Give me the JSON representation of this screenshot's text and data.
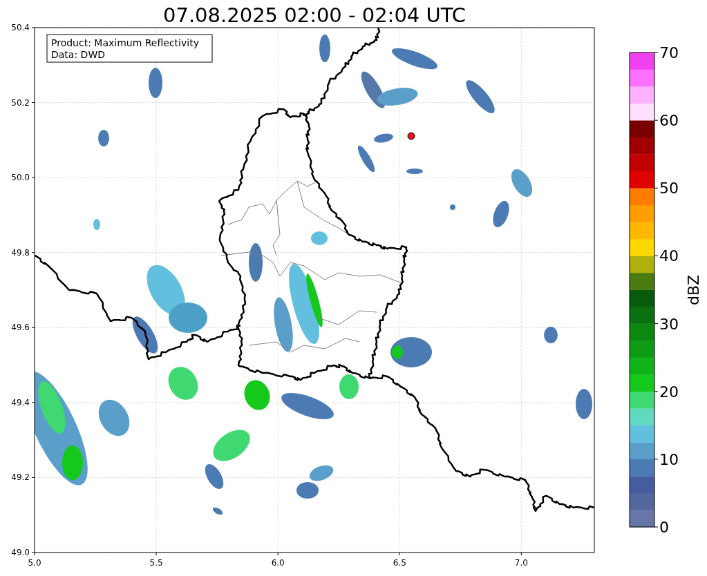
{
  "title": "07.08.2025 02:00 - 02:04 UTC",
  "annotation": [
    "Product: Maximum Reflectivity",
    "Data: DWD"
  ],
  "x_axis": {
    "ticks": [
      "5.0",
      "5.5",
      "6.0",
      "6.5",
      "7.0"
    ]
  },
  "y_axis": {
    "ticks": [
      "50.4",
      "50.2",
      "50.0",
      "49.8",
      "49.6",
      "49.4",
      "49.2",
      "49.0"
    ]
  },
  "colorbar": {
    "label": "dBZ",
    "ticks": [
      "70",
      "60",
      "50",
      "40",
      "30",
      "20",
      "10",
      "0"
    ],
    "bins": [
      {
        "color": "#6676a8"
      },
      {
        "color": "#53669e"
      },
      {
        "color": "#455c9e"
      },
      {
        "color": "#4c7bb4"
      },
      {
        "color": "#5a9fca"
      },
      {
        "color": "#62c0de"
      },
      {
        "color": "#62d8c0"
      },
      {
        "color": "#40d870"
      },
      {
        "color": "#14c81c"
      },
      {
        "color": "#10b41a"
      },
      {
        "color": "#0e9c14"
      },
      {
        "color": "#0c8810"
      },
      {
        "color": "#0a7010"
      },
      {
        "color": "#085a0c"
      },
      {
        "color": "#4a7a10"
      },
      {
        "color": "#b0b00c"
      },
      {
        "color": "#ffd800"
      },
      {
        "color": "#ffb800"
      },
      {
        "color": "#ff9c00"
      },
      {
        "color": "#ff7c00"
      },
      {
        "color": "#e00000"
      },
      {
        "color": "#c00000"
      },
      {
        "color": "#a00000"
      },
      {
        "color": "#780000"
      },
      {
        "color": "#ffe0ff"
      },
      {
        "color": "#ffb0ff"
      },
      {
        "color": "#ff70ff"
      },
      {
        "color": "#f040f0"
      }
    ]
  }
}
